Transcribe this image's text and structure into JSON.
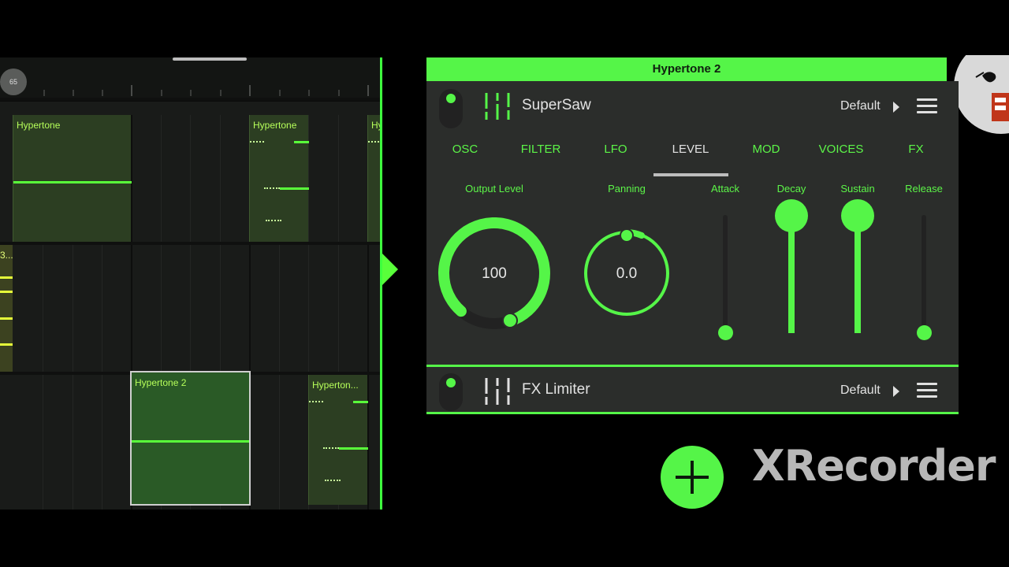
{
  "arrangement": {
    "position_badge": "65",
    "clips": {
      "hypertone_top_left": "Hypertone",
      "hypertone_top_mid": "Hypertone",
      "hypertone_top_right": "Hy",
      "left_cut": "3...",
      "hypertone2_selected": "Hypertone 2",
      "hypertone_truncated": "Hyperton..."
    }
  },
  "panel": {
    "title": "Hypertone 2",
    "synth": {
      "name": "SuperSaw",
      "preset": "Default"
    },
    "tabs": [
      "OSC",
      "FILTER",
      "LFO",
      "LEVEL",
      "MOD",
      "VOICES",
      "FX"
    ],
    "active_tab": "LEVEL",
    "params": {
      "output_level": {
        "label": "Output Level",
        "value": "100"
      },
      "panning": {
        "label": "Panning",
        "value": "0.0"
      },
      "attack": {
        "label": "Attack",
        "level": 0.0
      },
      "decay": {
        "label": "Decay",
        "level": 1.0
      },
      "sustain": {
        "label": "Sustain",
        "level": 1.0
      },
      "release": {
        "label": "Release",
        "level": 0.0
      }
    },
    "fx": {
      "name": "FX Limiter",
      "preset": "Default"
    }
  },
  "watermark": "XRecorder",
  "colors": {
    "accent": "#55f548",
    "background": "#2b2d2b",
    "clip": "#2c3e22"
  }
}
